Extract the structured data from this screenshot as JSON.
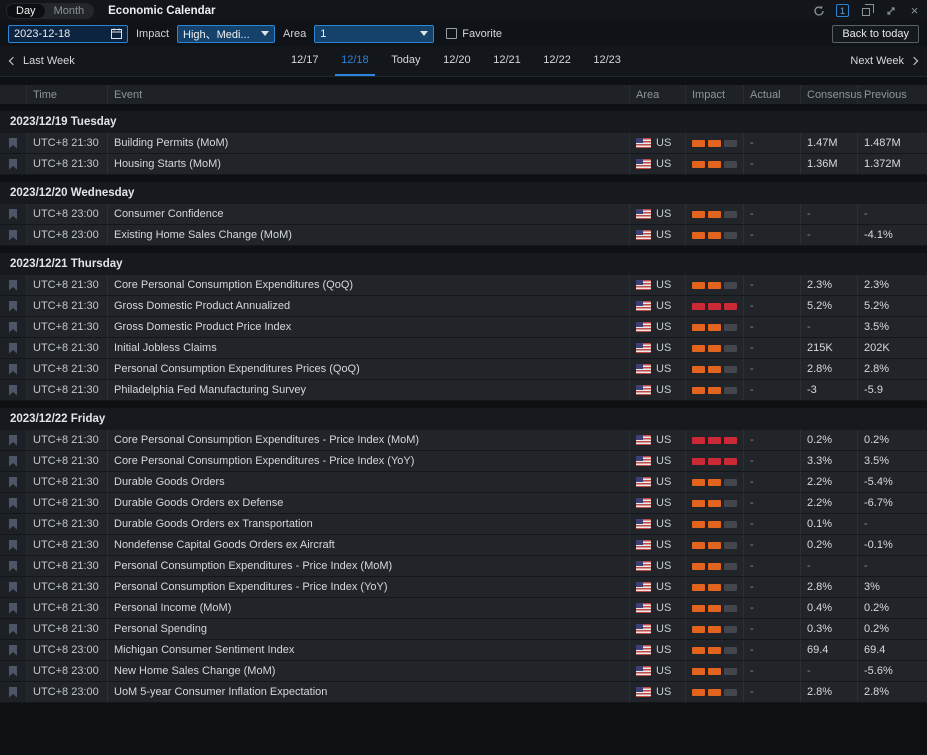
{
  "titlebar": {
    "tabs": [
      {
        "label": "Day",
        "active": true
      },
      {
        "label": "Month",
        "active": false
      }
    ],
    "title": "Economic Calendar",
    "count_badge": "1"
  },
  "filters": {
    "date_value": "2023-12-18",
    "impact_label": "Impact",
    "impact_value": "High、Medi...",
    "area_label": "Area",
    "area_value": "1",
    "favorite_label": "Favorite",
    "back_to_today_label": "Back to today"
  },
  "week_nav": {
    "prev_label": "Last Week",
    "next_label": "Next Week",
    "days": [
      {
        "label": "12/17",
        "selected": false
      },
      {
        "label": "12/18",
        "selected": true
      },
      {
        "label": "Today",
        "selected": false
      },
      {
        "label": "12/20",
        "selected": false
      },
      {
        "label": "12/21",
        "selected": false
      },
      {
        "label": "12/22",
        "selected": false
      },
      {
        "label": "12/23",
        "selected": false
      }
    ]
  },
  "table": {
    "headers": [
      "Time",
      "Event",
      "Area",
      "Impact",
      "Actual",
      "Consensus",
      "Previous"
    ]
  },
  "colors": {
    "accent_blue": "#2b85d0",
    "impact_medium": "#e2641e",
    "impact_high": "#cc2936",
    "impact_empty": "#43474d"
  },
  "groups": [
    {
      "date": "2023/12/19 Tuesday",
      "rows": [
        {
          "time": "UTC+8 21:30",
          "event": "Building Permits (MoM)",
          "area": "US",
          "impact": "medium",
          "actual": "-",
          "consensus": "1.47M",
          "previous": "1.487M"
        },
        {
          "time": "UTC+8 21:30",
          "event": "Housing Starts (MoM)",
          "area": "US",
          "impact": "medium",
          "actual": "-",
          "consensus": "1.36M",
          "previous": "1.372M"
        }
      ]
    },
    {
      "date": "2023/12/20 Wednesday",
      "rows": [
        {
          "time": "UTC+8 23:00",
          "event": "Consumer Confidence",
          "area": "US",
          "impact": "medium",
          "actual": "-",
          "consensus": "-",
          "previous": "-"
        },
        {
          "time": "UTC+8 23:00",
          "event": "Existing Home Sales Change (MoM)",
          "area": "US",
          "impact": "medium",
          "actual": "-",
          "consensus": "-",
          "previous": "-4.1%"
        }
      ]
    },
    {
      "date": "2023/12/21 Thursday",
      "rows": [
        {
          "time": "UTC+8 21:30",
          "event": "Core Personal Consumption Expenditures (QoQ)",
          "area": "US",
          "impact": "medium",
          "actual": "-",
          "consensus": "2.3%",
          "previous": "2.3%"
        },
        {
          "time": "UTC+8 21:30",
          "event": "Gross Domestic Product Annualized",
          "area": "US",
          "impact": "high",
          "actual": "-",
          "consensus": "5.2%",
          "previous": "5.2%"
        },
        {
          "time": "UTC+8 21:30",
          "event": "Gross Domestic Product Price Index",
          "area": "US",
          "impact": "medium",
          "actual": "-",
          "consensus": "-",
          "previous": "3.5%"
        },
        {
          "time": "UTC+8 21:30",
          "event": "Initial Jobless Claims",
          "area": "US",
          "impact": "medium",
          "actual": "-",
          "consensus": "215K",
          "previous": "202K"
        },
        {
          "time": "UTC+8 21:30",
          "event": "Personal Consumption Expenditures Prices (QoQ)",
          "area": "US",
          "impact": "medium",
          "actual": "-",
          "consensus": "2.8%",
          "previous": "2.8%"
        },
        {
          "time": "UTC+8 21:30",
          "event": "Philadelphia Fed Manufacturing Survey",
          "area": "US",
          "impact": "medium",
          "actual": "-",
          "consensus": "-3",
          "previous": "-5.9"
        }
      ]
    },
    {
      "date": "2023/12/22 Friday",
      "rows": [
        {
          "time": "UTC+8 21:30",
          "event": "Core Personal Consumption Expenditures - Price Index (MoM)",
          "area": "US",
          "impact": "high",
          "actual": "-",
          "consensus": "0.2%",
          "previous": "0.2%"
        },
        {
          "time": "UTC+8 21:30",
          "event": "Core Personal Consumption Expenditures - Price Index (YoY)",
          "area": "US",
          "impact": "high",
          "actual": "-",
          "consensus": "3.3%",
          "previous": "3.5%"
        },
        {
          "time": "UTC+8 21:30",
          "event": "Durable Goods Orders",
          "area": "US",
          "impact": "medium",
          "actual": "-",
          "consensus": "2.2%",
          "previous": "-5.4%"
        },
        {
          "time": "UTC+8 21:30",
          "event": "Durable Goods Orders ex Defense",
          "area": "US",
          "impact": "medium",
          "actual": "-",
          "consensus": "2.2%",
          "previous": "-6.7%"
        },
        {
          "time": "UTC+8 21:30",
          "event": "Durable Goods Orders ex Transportation",
          "area": "US",
          "impact": "medium",
          "actual": "-",
          "consensus": "0.1%",
          "previous": "-"
        },
        {
          "time": "UTC+8 21:30",
          "event": "Nondefense Capital Goods Orders ex Aircraft",
          "area": "US",
          "impact": "medium",
          "actual": "-",
          "consensus": "0.2%",
          "previous": "-0.1%"
        },
        {
          "time": "UTC+8 21:30",
          "event": "Personal Consumption Expenditures - Price Index (MoM)",
          "area": "US",
          "impact": "medium",
          "actual": "-",
          "consensus": "-",
          "previous": "-"
        },
        {
          "time": "UTC+8 21:30",
          "event": "Personal Consumption Expenditures - Price Index (YoY)",
          "area": "US",
          "impact": "medium",
          "actual": "-",
          "consensus": "2.8%",
          "previous": "3%"
        },
        {
          "time": "UTC+8 21:30",
          "event": "Personal Income (MoM)",
          "area": "US",
          "impact": "medium",
          "actual": "-",
          "consensus": "0.4%",
          "previous": "0.2%"
        },
        {
          "time": "UTC+8 21:30",
          "event": "Personal Spending",
          "area": "US",
          "impact": "medium",
          "actual": "-",
          "consensus": "0.3%",
          "previous": "0.2%"
        },
        {
          "time": "UTC+8 23:00",
          "event": "Michigan Consumer Sentiment Index",
          "area": "US",
          "impact": "medium",
          "actual": "-",
          "consensus": "69.4",
          "previous": "69.4"
        },
        {
          "time": "UTC+8 23:00",
          "event": "New Home Sales Change (MoM)",
          "area": "US",
          "impact": "medium",
          "actual": "-",
          "consensus": "-",
          "previous": "-5.6%"
        },
        {
          "time": "UTC+8 23:00",
          "event": "UoM 5-year Consumer Inflation Expectation",
          "area": "US",
          "impact": "medium",
          "actual": "-",
          "consensus": "2.8%",
          "previous": "2.8%"
        }
      ]
    }
  ]
}
